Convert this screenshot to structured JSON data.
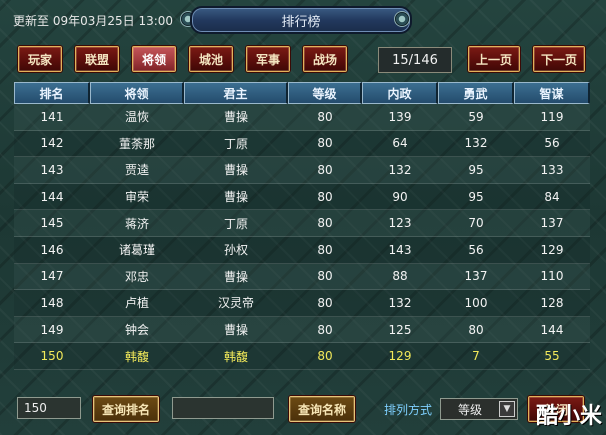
{
  "header": {
    "updated": "更新至 09年03月25日 13:00",
    "title": "排行榜"
  },
  "tabs": [
    {
      "label": "玩家",
      "active": false
    },
    {
      "label": "联盟",
      "active": false
    },
    {
      "label": "将领",
      "active": true
    },
    {
      "label": "城池",
      "active": false
    },
    {
      "label": "军事",
      "active": false
    },
    {
      "label": "战场",
      "active": false
    }
  ],
  "pager": {
    "page": "15/146",
    "prev_label": "上一页",
    "next_label": "下一页"
  },
  "table": {
    "headers": [
      "排名",
      "将领",
      "君主",
      "等级",
      "内政",
      "勇武",
      "智谋"
    ],
    "rows": [
      [
        "141",
        "温恢",
        "曹操",
        "80",
        "139",
        "59",
        "119"
      ],
      [
        "142",
        "董荼那",
        "丁原",
        "80",
        "64",
        "132",
        "56"
      ],
      [
        "143",
        "贾逵",
        "曹操",
        "80",
        "132",
        "95",
        "133"
      ],
      [
        "144",
        "审荣",
        "曹操",
        "80",
        "90",
        "95",
        "84"
      ],
      [
        "145",
        "蒋济",
        "丁原",
        "80",
        "123",
        "70",
        "137"
      ],
      [
        "146",
        "诸葛瑾",
        "孙权",
        "80",
        "143",
        "56",
        "129"
      ],
      [
        "147",
        "邓忠",
        "曹操",
        "80",
        "88",
        "137",
        "110"
      ],
      [
        "148",
        "卢植",
        "汉灵帝",
        "80",
        "132",
        "100",
        "128"
      ],
      [
        "149",
        "钟会",
        "曹操",
        "80",
        "125",
        "80",
        "144"
      ],
      [
        "150",
        "韩馥",
        "韩馥",
        "80",
        "129",
        "7",
        "55"
      ]
    ],
    "highlight_row": 9,
    "highlight_color": "#f2e95a"
  },
  "footer": {
    "rank_input_value": "150",
    "rank_search_label": "查询排名",
    "name_input_value": "",
    "name_search_label": "查询名称",
    "sort_label": "排列方式",
    "sort_value": "等级",
    "close_label": "关闭"
  },
  "watermark": "酷小米"
}
